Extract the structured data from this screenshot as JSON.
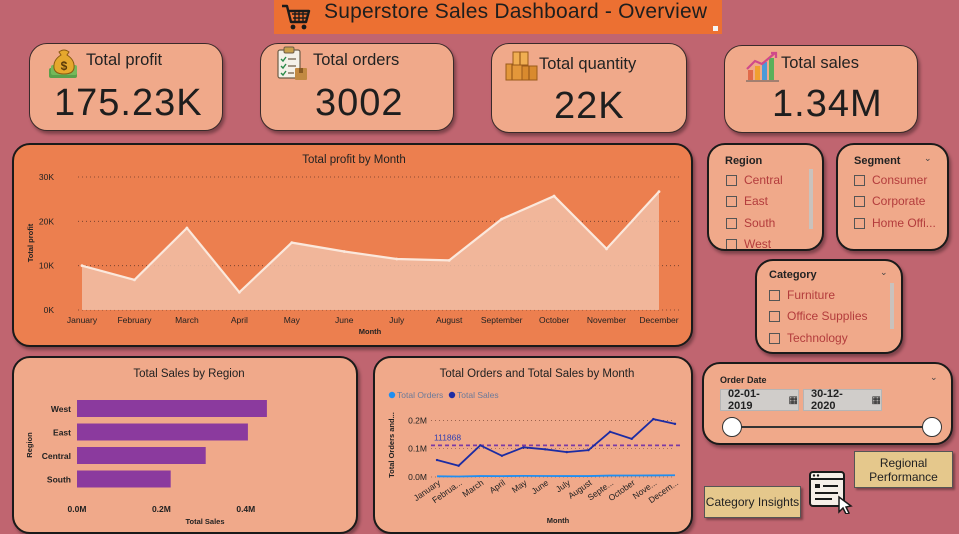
{
  "header": {
    "title": "Superstore Sales Dashboard - Overview"
  },
  "kpis": {
    "profit": {
      "label": "Total profit",
      "value": "175.23K"
    },
    "orders": {
      "label": "Total orders",
      "value": "3002"
    },
    "quantity": {
      "label": "Total quantity",
      "value": "22K"
    },
    "sales": {
      "label": "Total sales",
      "value": "1.34M"
    }
  },
  "slicers": {
    "region": {
      "title": "Region",
      "items": [
        "Central",
        "East",
        "South",
        "West"
      ]
    },
    "segment": {
      "title": "Segment",
      "items": [
        "Consumer",
        "Corporate",
        "Home Offi..."
      ]
    },
    "category": {
      "title": "Category",
      "items": [
        "Furniture",
        "Office Supplies",
        "Technology"
      ]
    },
    "order_date": {
      "title": "Order Date",
      "start": "02-01-2019",
      "end": "30-12-2020"
    }
  },
  "buttons": {
    "category_insights": "Category Insights",
    "regional_performance": "Regional Performance"
  },
  "colors": {
    "background": "#c06570",
    "accent": "#ec7032",
    "card": "#f0a98a",
    "profit_panel": "#ec7f4f",
    "bar": "#8b3a9e",
    "sales_line": "#1c2ca3",
    "orders_line": "#1f8ef1"
  },
  "chart_data": [
    {
      "type": "area",
      "title": "Total profit by Month",
      "xlabel": "Month",
      "ylabel": "Total profit",
      "categories": [
        "January",
        "February",
        "March",
        "April",
        "May",
        "June",
        "July",
        "August",
        "September",
        "October",
        "November",
        "December"
      ],
      "values": [
        10000,
        6800,
        18500,
        4000,
        15200,
        13200,
        11500,
        11200,
        20500,
        25700,
        13800,
        26700
      ],
      "yticks": [
        "0K",
        "10K",
        "20K",
        "30K"
      ],
      "ylim": [
        0,
        30000
      ]
    },
    {
      "type": "bar",
      "title": "Total Sales by Region",
      "xlabel": "Total Sales",
      "ylabel": "Region",
      "categories": [
        "West",
        "East",
        "Central",
        "South"
      ],
      "values": [
        450000,
        405000,
        305000,
        222000
      ],
      "xticks": [
        "0.0M",
        "0.2M",
        "0.4M"
      ],
      "xlim": [
        0,
        500000
      ]
    },
    {
      "type": "line",
      "title": "Total Orders and Total Sales by Month",
      "xlabel": "Month",
      "ylabel": "Total Orders and...",
      "categories": [
        "January",
        "February",
        "March",
        "April",
        "May",
        "June",
        "July",
        "August",
        "September",
        "October",
        "November",
        "December"
      ],
      "tick_labels": [
        "January",
        "Februa...",
        "March",
        "April",
        "May",
        "June",
        "July",
        "August",
        "Septe...",
        "October",
        "Nove...",
        "Decem..."
      ],
      "series": [
        {
          "name": "Total Orders",
          "values": [
            250,
            180,
            330,
            310,
            390,
            360,
            340,
            330,
            510,
            540,
            560,
            610
          ]
        },
        {
          "name": "Total Sales",
          "values": [
            60000,
            40000,
            112000,
            75000,
            105000,
            98000,
            88000,
            95000,
            160000,
            135000,
            205000,
            188000
          ]
        }
      ],
      "reference_line": {
        "value": 111868,
        "label": "111868"
      },
      "yticks": [
        "0.0M",
        "0.1M",
        "0.2M"
      ],
      "ylim": [
        0,
        230000
      ]
    }
  ]
}
